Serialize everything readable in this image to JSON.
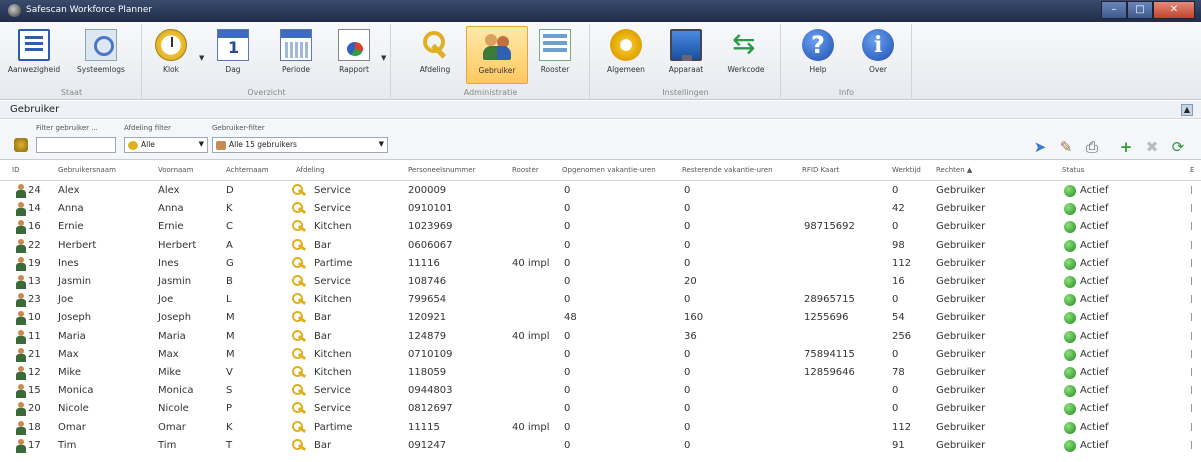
{
  "window": {
    "title": "Safescan Workforce Planner"
  },
  "ribbon": {
    "groups": [
      {
        "label": "Staat",
        "buttons": [
          {
            "label": "Aanwezigheid"
          },
          {
            "label": "Systeemlogs"
          }
        ]
      },
      {
        "label": "Overzicht",
        "buttons": [
          {
            "label": "Klok"
          },
          {
            "label": "Dag"
          },
          {
            "label": "Periode"
          },
          {
            "label": "Rapport"
          }
        ]
      },
      {
        "label": "Administratie",
        "buttons": [
          {
            "label": "Afdeling"
          },
          {
            "label": "Gebruiker"
          },
          {
            "label": "Rooster"
          }
        ]
      },
      {
        "label": "Instellingen",
        "buttons": [
          {
            "label": "Algemeen"
          },
          {
            "label": "Apparaat"
          },
          {
            "label": "Werkcode"
          }
        ]
      },
      {
        "label": "Info",
        "buttons": [
          {
            "label": "Help"
          },
          {
            "label": "Over"
          }
        ]
      }
    ],
    "active_button": "Gebruiker"
  },
  "panel": {
    "title": "Gebruiker",
    "filters": {
      "filter_label": "Filter gebruiker ...",
      "filter_value": "",
      "dept_label": "Afdeling filter",
      "dept_value": "Alle",
      "user_label": "Gebruiker-filter",
      "user_value": "Alle 15 gebruikers"
    }
  },
  "table": {
    "columns": [
      "ID",
      "Gebruikersnaam",
      "Voornaam",
      "Achternaam",
      "Afdeling",
      "Personeelsnummer",
      "Rooster",
      "Opgenomen vakantie-uren",
      "Resterende vakantie-uren",
      "RFID Kaart",
      "Werktijd",
      "Rechten",
      "Status"
    ],
    "rows": [
      {
        "id": "24",
        "username": "Alex",
        "first": "Alex",
        "last": "D",
        "dept": "Service",
        "pnum": "200009",
        "rooster": "",
        "taken": "0",
        "remaining": "0",
        "rfid": "",
        "worktime": "0",
        "rights": "Gebruiker",
        "status": "Actief"
      },
      {
        "id": "14",
        "username": "Anna",
        "first": "Anna",
        "last": "K",
        "dept": "Service",
        "pnum": "0910101",
        "rooster": "",
        "taken": "0",
        "remaining": "0",
        "rfid": "",
        "worktime": "42",
        "rights": "Gebruiker",
        "status": "Actief"
      },
      {
        "id": "16",
        "username": "Ernie",
        "first": "Ernie",
        "last": "C",
        "dept": "Kitchen",
        "pnum": "1023969",
        "rooster": "",
        "taken": "0",
        "remaining": "0",
        "rfid": "98715692",
        "worktime": "0",
        "rights": "Gebruiker",
        "status": "Actief"
      },
      {
        "id": "22",
        "username": "Herbert",
        "first": "Herbert",
        "last": "A",
        "dept": "Bar",
        "pnum": "0606067",
        "rooster": "",
        "taken": "0",
        "remaining": "0",
        "rfid": "",
        "worktime": "98",
        "rights": "Gebruiker",
        "status": "Actief"
      },
      {
        "id": "19",
        "username": "Ines",
        "first": "Ines",
        "last": "G",
        "dept": "Partime",
        "pnum": "11116",
        "rooster": "40 impl",
        "taken": "0",
        "remaining": "0",
        "rfid": "",
        "worktime": "112",
        "rights": "Gebruiker",
        "status": "Actief"
      },
      {
        "id": "13",
        "username": "Jasmin",
        "first": "Jasmin",
        "last": "B",
        "dept": "Service",
        "pnum": "108746",
        "rooster": "",
        "taken": "0",
        "remaining": "20",
        "rfid": "",
        "worktime": "16",
        "rights": "Gebruiker",
        "status": "Actief"
      },
      {
        "id": "23",
        "username": "Joe",
        "first": "Joe",
        "last": "L",
        "dept": "Kitchen",
        "pnum": "799654",
        "rooster": "",
        "taken": "0",
        "remaining": "0",
        "rfid": "28965715",
        "worktime": "0",
        "rights": "Gebruiker",
        "status": "Actief"
      },
      {
        "id": "10",
        "username": "Joseph",
        "first": "Joseph",
        "last": "M",
        "dept": "Bar",
        "pnum": "120921",
        "rooster": "",
        "taken": "48",
        "remaining": "160",
        "rfid": "1255696",
        "worktime": "54",
        "rights": "Gebruiker",
        "status": "Actief"
      },
      {
        "id": "11",
        "username": "Maria",
        "first": "Maria",
        "last": "M",
        "dept": "Bar",
        "pnum": "124879",
        "rooster": "40 impl",
        "taken": "0",
        "remaining": "36",
        "rfid": "",
        "worktime": "256",
        "rights": "Gebruiker",
        "status": "Actief"
      },
      {
        "id": "21",
        "username": "Max",
        "first": "Max",
        "last": "M",
        "dept": "Kitchen",
        "pnum": "0710109",
        "rooster": "",
        "taken": "0",
        "remaining": "0",
        "rfid": "75894115",
        "worktime": "0",
        "rights": "Gebruiker",
        "status": "Actief"
      },
      {
        "id": "12",
        "username": "Mike",
        "first": "Mike",
        "last": "V",
        "dept": "Kitchen",
        "pnum": "118059",
        "rooster": "",
        "taken": "0",
        "remaining": "0",
        "rfid": "12859646",
        "worktime": "78",
        "rights": "Gebruiker",
        "status": "Actief"
      },
      {
        "id": "15",
        "username": "Monica",
        "first": "Monica",
        "last": "S",
        "dept": "Service",
        "pnum": "0944803",
        "rooster": "",
        "taken": "0",
        "remaining": "0",
        "rfid": "",
        "worktime": "0",
        "rights": "Gebruiker",
        "status": "Actief"
      },
      {
        "id": "20",
        "username": "Nicole",
        "first": "Nicole",
        "last": "P",
        "dept": "Service",
        "pnum": "0812697",
        "rooster": "",
        "taken": "0",
        "remaining": "0",
        "rfid": "",
        "worktime": "0",
        "rights": "Gebruiker",
        "status": "Actief"
      },
      {
        "id": "18",
        "username": "Omar",
        "first": "Omar",
        "last": "K",
        "dept": "Partime",
        "pnum": "11115",
        "rooster": "40 impl",
        "taken": "0",
        "remaining": "0",
        "rfid": "",
        "worktime": "112",
        "rights": "Gebruiker",
        "status": "Actief"
      },
      {
        "id": "17",
        "username": "Tim",
        "first": "Tim",
        "last": "T",
        "dept": "Bar",
        "pnum": "091247",
        "rooster": "",
        "taken": "0",
        "remaining": "0",
        "rfid": "",
        "worktime": "91",
        "rights": "Gebruiker",
        "status": "Actief"
      }
    ]
  },
  "colors": {
    "titlebar": "#2b3a5a",
    "active_button": "#ffc861",
    "status_active": "#1f8a1f"
  }
}
